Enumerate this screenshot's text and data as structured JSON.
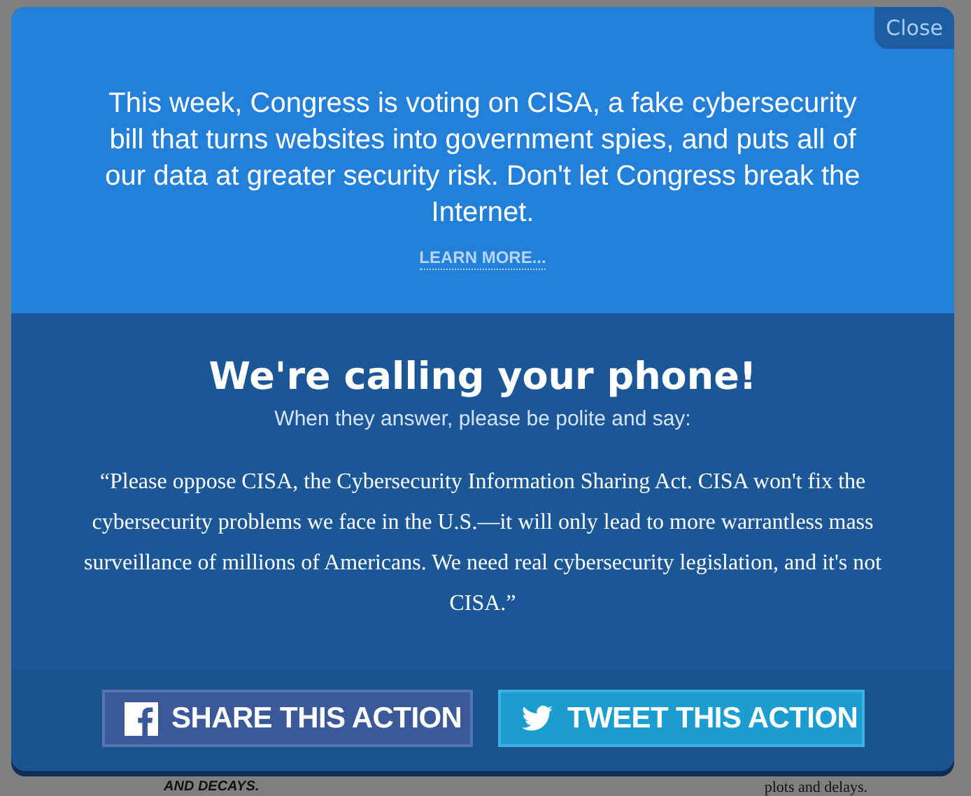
{
  "background_page": {
    "bottom_left": "AND DECAYS.",
    "bottom_right": "plots and delays."
  },
  "modal": {
    "close": "Close",
    "message": "This week, Congress is voting on CISA, a fake cybersecurity bill that turns websites into government spies, and puts all of our data at greater security risk. Don't let Congress break the Internet.",
    "learn_more": "LEARN MORE...",
    "heading": "We're calling your phone!",
    "subheading": "When they answer, please be polite and say:",
    "script": "“Please oppose CISA, the Cybersecurity Information Sharing Act. CISA won't fix the cybersecurity problems we face in the U.S.—it will only lead to more warrantless mass surveillance of millions of Americans. We need real cybersecurity legislation, and it's not CISA.”",
    "buttons": [
      {
        "kind": "facebook",
        "label": "SHARE THIS ACTION"
      },
      {
        "kind": "twitter",
        "label": "TWEET THIS ACTION"
      }
    ]
  }
}
